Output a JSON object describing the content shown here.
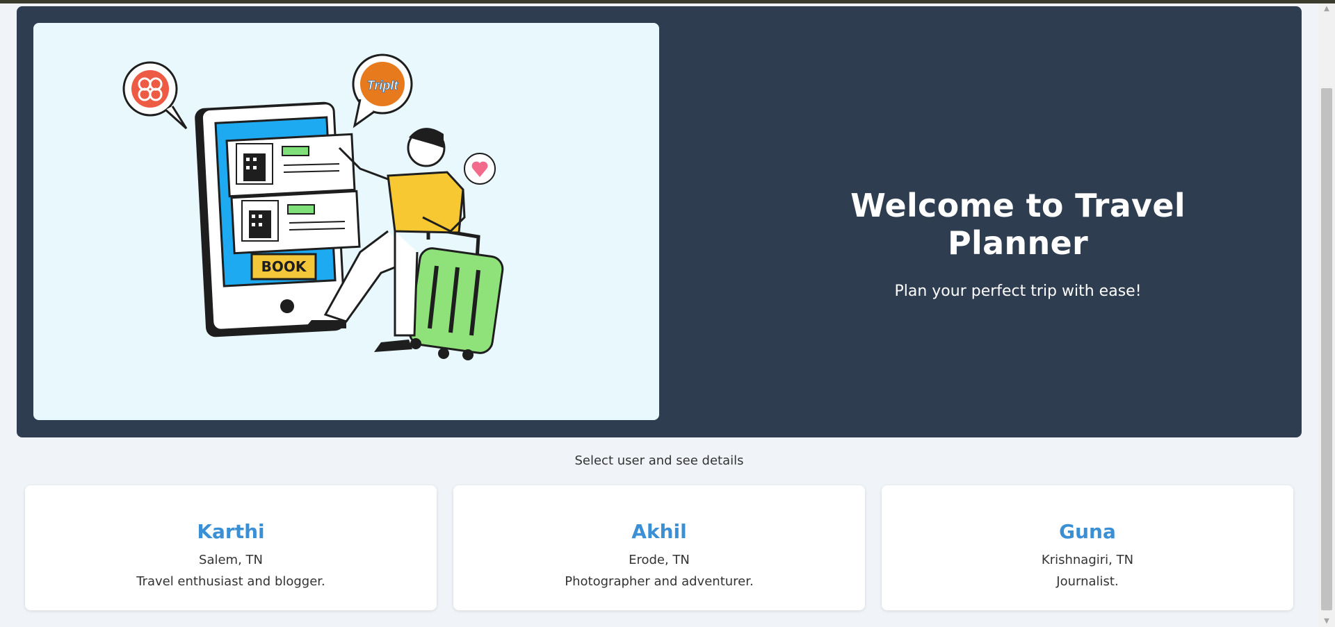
{
  "hero": {
    "title": "Welcome to Travel Planner",
    "subtitle": "Plan your perfect trip with ease!",
    "illustration": {
      "book_button_label": "BOOK",
      "tripit_logo_text": "TripIt"
    }
  },
  "section": {
    "caption": "Select user and see details"
  },
  "users": [
    {
      "name": "Karthi",
      "location": "Salem, TN",
      "bio": "Travel enthusiast and blogger."
    },
    {
      "name": "Akhil",
      "location": "Erode, TN",
      "bio": "Photographer and adventurer."
    },
    {
      "name": "Guna",
      "location": "Krishnagiri, TN",
      "bio": "Journalist."
    }
  ],
  "colors": {
    "hero_bg": "#2e3d50",
    "illustration_bg": "#e8f8fd",
    "page_bg": "#f0f3f7",
    "name_accent": "#3b8fd4"
  },
  "icons": {
    "scroll_up": "triangle-up-icon",
    "scroll_down": "triangle-down-icon"
  }
}
